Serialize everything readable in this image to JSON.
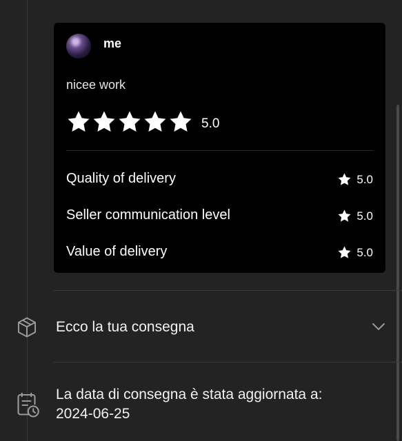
{
  "review": {
    "reviewer": "me",
    "text": "nicee work",
    "overall_rating": 5.0,
    "overall_score_text": "5.0",
    "criteria": [
      {
        "label": "Quality of delivery",
        "score": "5.0"
      },
      {
        "label": "Seller communication level",
        "score": "5.0"
      },
      {
        "label": "Value of delivery",
        "score": "5.0"
      }
    ]
  },
  "delivery": {
    "label": "Ecco la tua consegna",
    "icon": "box-icon",
    "toggle_icon": "chevron-down-icon"
  },
  "update": {
    "line1": "La data di consegna è stata aggiornata a:",
    "line2": "2024-06-25",
    "icon": "calendar-clock-icon"
  },
  "colors": {
    "background": "#232323",
    "card": "#000000",
    "text": "#ffffff",
    "muted": "#9a9a9a"
  }
}
